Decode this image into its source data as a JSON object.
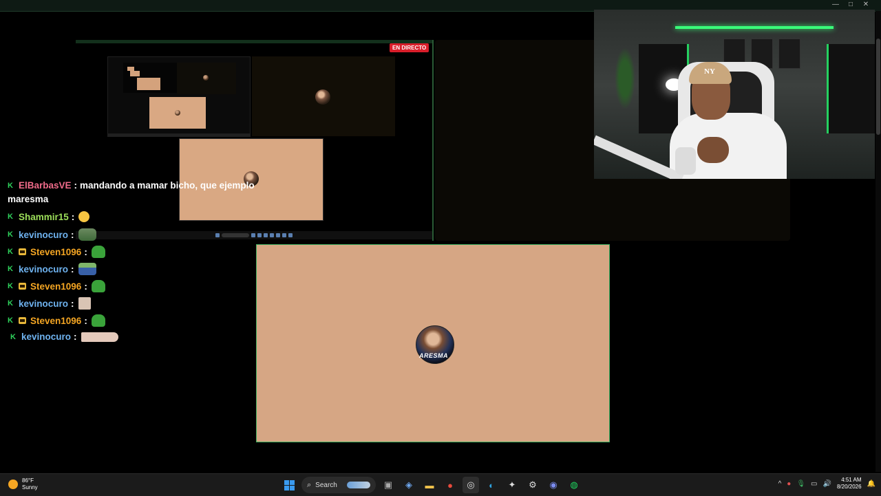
{
  "live_badge": "EN DIRECTO",
  "chat": [
    {
      "badges": [
        "k"
      ],
      "user": "ElBarbasVE",
      "color": "#f06b8a",
      "text": "mandando a mamar bicho, que ejemplo",
      "text2": "maresma",
      "emote": ""
    },
    {
      "badges": [
        "k"
      ],
      "user": "Shammir15",
      "color": "#9de05a",
      "text": "",
      "emote": "face"
    },
    {
      "badges": [
        "k"
      ],
      "user": "kevinocuro",
      "color": "#6fb3f0",
      "text": "",
      "emote": "pepe2"
    },
    {
      "badges": [
        "k",
        "c"
      ],
      "user": "Steven1096",
      "color": "#f5a623",
      "text": "",
      "emote": "pepe"
    },
    {
      "badges": [
        "k"
      ],
      "user": "kevinocuro",
      "color": "#6fb3f0",
      "text": "",
      "emote": "boat"
    },
    {
      "badges": [
        "k",
        "c"
      ],
      "user": "Steven1096",
      "color": "#f5a623",
      "text": "",
      "emote": "pepe"
    },
    {
      "badges": [
        "k"
      ],
      "user": "kevinocuro",
      "color": "#6fb3f0",
      "text": "",
      "emote": "sq"
    },
    {
      "badges": [
        "k",
        "c"
      ],
      "user": "Steven1096",
      "color": "#f5a623",
      "text": "",
      "emote": "pepe"
    },
    {
      "badges": [
        "k"
      ],
      "user": "kevinocuro",
      "color": "#6fb3f0",
      "text": "",
      "emote": "hand"
    }
  ],
  "avatar_text": "ARESMA",
  "webcam_cap_logo": "NY",
  "taskbar": {
    "weather_temp": "86°F",
    "weather_desc": "Sunny",
    "search_label": "Search",
    "time": "4:51 AM",
    "date": "8/20/2026"
  },
  "colors": {
    "accent": "#3cb060",
    "peach": "#d6a684",
    "live": "#d81e2a"
  }
}
